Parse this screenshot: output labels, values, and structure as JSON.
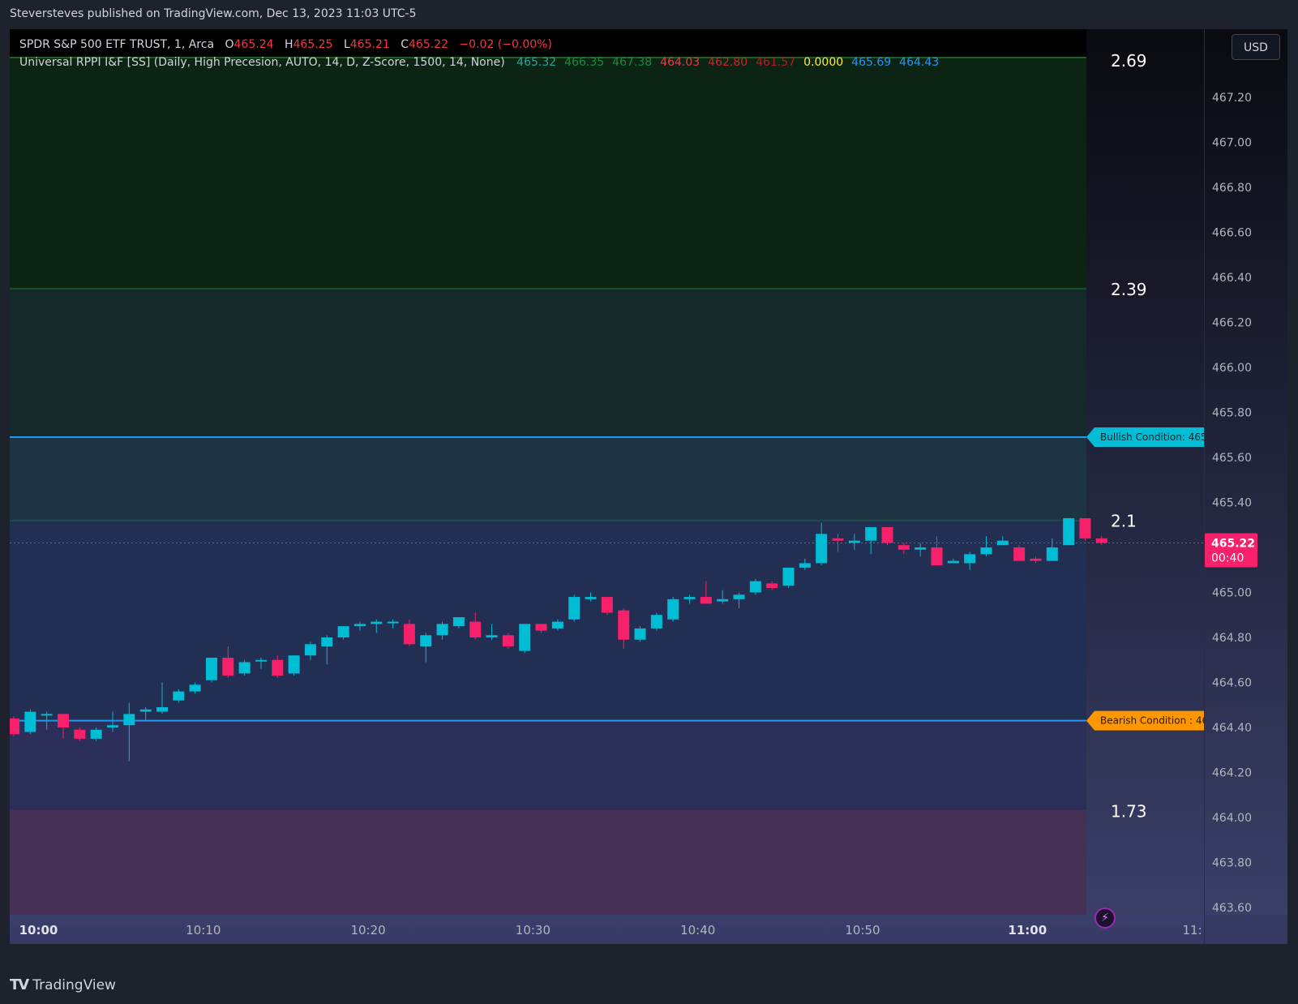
{
  "publisher": "Steversteves published on TradingView.com, Dec 13, 2023 11:03 UTC-5",
  "legend": {
    "symbol": "SPDR S&P 500 ETF TRUST, 1, Arca",
    "open_label": "O",
    "open": "465.24",
    "high_label": "H",
    "high": "465.25",
    "low_label": "L",
    "low": "465.21",
    "close_label": "C",
    "close": "465.22",
    "change": "−0.02 (−0.00%)",
    "indicator": "Universal RPPI I&F [SS] (Daily, High Precesion, AUTO, 14, D, Z-Score, 1500, 14, None)",
    "indicator_values": [
      {
        "text": "465.32",
        "color": "#26a69a"
      },
      {
        "text": "466.35",
        "color": "#1b8a3a"
      },
      {
        "text": "467.38",
        "color": "#1b8a3a"
      },
      {
        "text": "464.03",
        "color": "#f23645"
      },
      {
        "text": "462.80",
        "color": "#c62828"
      },
      {
        "text": "461.57",
        "color": "#b71c1c"
      },
      {
        "text": "0.0000",
        "color": "#ffeb3b"
      },
      {
        "text": "465.69",
        "color": "#2196f3"
      },
      {
        "text": "464.43",
        "color": "#2196f3"
      }
    ]
  },
  "currency": "USD",
  "brand": "TradingView",
  "colors": {
    "up": "#00bcd4",
    "down": "#f7206a",
    "bullish_line": "#2196f3",
    "bearish_tag": "#ff9800",
    "bullish_tag": "#00bcd4",
    "last_price_tag": "#f7206a"
  },
  "chart_data": {
    "type": "candlestick",
    "symbol": "SPY",
    "interval": "1",
    "ylim": [
      463.55,
      467.38
    ],
    "y_ticks": [
      "467.20",
      "467.00",
      "466.80",
      "466.60",
      "466.40",
      "466.20",
      "466.00",
      "465.80",
      "465.60",
      "465.40",
      "465.20",
      "465.00",
      "464.80",
      "464.60",
      "464.40",
      "464.20",
      "464.00",
      "463.80",
      "463.60"
    ],
    "x_labels": [
      {
        "t": 0,
        "text": "10:00",
        "bold": true
      },
      {
        "t": 10,
        "text": "10:10",
        "bold": false
      },
      {
        "t": 20,
        "text": "10:20",
        "bold": false
      },
      {
        "t": 30,
        "text": "10:30",
        "bold": false
      },
      {
        "t": 40,
        "text": "10:40",
        "bold": false
      },
      {
        "t": 50,
        "text": "10:50",
        "bold": false
      },
      {
        "t": 60,
        "text": "11:00",
        "bold": true
      },
      {
        "t": 70,
        "text": "11:",
        "bold": false
      }
    ],
    "x_first": -1.5,
    "candles": [
      [
        -1.5,
        464.44,
        464.37,
        464.45,
        464.36
      ],
      [
        -0.5,
        464.38,
        464.47,
        464.48,
        464.37
      ],
      [
        0.5,
        464.46,
        464.46,
        464.47,
        464.39
      ],
      [
        1.5,
        464.46,
        464.4,
        464.46,
        464.35
      ],
      [
        2.5,
        464.39,
        464.35,
        464.4,
        464.34
      ],
      [
        3.5,
        464.35,
        464.39,
        464.4,
        464.34
      ],
      [
        4.5,
        464.4,
        464.41,
        464.47,
        464.38
      ],
      [
        5.5,
        464.41,
        464.46,
        464.51,
        464.25
      ],
      [
        6.5,
        464.47,
        464.48,
        464.49,
        464.43
      ],
      [
        7.5,
        464.47,
        464.49,
        464.6,
        464.46
      ],
      [
        8.5,
        464.52,
        464.56,
        464.57,
        464.51
      ],
      [
        9.5,
        464.56,
        464.59,
        464.6,
        464.55
      ],
      [
        10.5,
        464.61,
        464.71,
        464.71,
        464.6
      ],
      [
        11.5,
        464.71,
        464.63,
        464.76,
        464.62
      ],
      [
        12.5,
        464.64,
        464.69,
        464.7,
        464.63
      ],
      [
        13.5,
        464.7,
        464.7,
        464.71,
        464.66
      ],
      [
        14.5,
        464.7,
        464.63,
        464.72,
        464.62
      ],
      [
        15.5,
        464.64,
        464.72,
        464.72,
        464.63
      ],
      [
        16.5,
        464.72,
        464.77,
        464.78,
        464.7
      ],
      [
        17.5,
        464.76,
        464.8,
        464.81,
        464.68
      ],
      [
        18.5,
        464.8,
        464.85,
        464.85,
        464.79
      ],
      [
        19.5,
        464.85,
        464.86,
        464.87,
        464.83
      ],
      [
        20.5,
        464.86,
        464.87,
        464.88,
        464.82
      ],
      [
        21.5,
        464.87,
        464.87,
        464.88,
        464.84
      ],
      [
        22.5,
        464.86,
        464.77,
        464.88,
        464.76
      ],
      [
        23.5,
        464.76,
        464.81,
        464.82,
        464.69
      ],
      [
        24.5,
        464.81,
        464.86,
        464.87,
        464.79
      ],
      [
        25.5,
        464.85,
        464.89,
        464.89,
        464.84
      ],
      [
        26.5,
        464.87,
        464.8,
        464.91,
        464.79
      ],
      [
        27.5,
        464.8,
        464.81,
        464.86,
        464.79
      ],
      [
        28.5,
        464.81,
        464.76,
        464.82,
        464.75
      ],
      [
        29.5,
        464.74,
        464.86,
        464.86,
        464.73
      ],
      [
        30.5,
        464.86,
        464.83,
        464.86,
        464.82
      ],
      [
        31.5,
        464.84,
        464.87,
        464.88,
        464.83
      ],
      [
        32.5,
        464.88,
        464.98,
        464.99,
        464.87
      ],
      [
        33.5,
        464.97,
        464.98,
        465.0,
        464.96
      ],
      [
        34.5,
        464.98,
        464.91,
        464.98,
        464.9
      ],
      [
        35.5,
        464.92,
        464.79,
        464.93,
        464.75
      ],
      [
        36.5,
        464.79,
        464.84,
        464.85,
        464.78
      ],
      [
        37.5,
        464.84,
        464.9,
        464.91,
        464.83
      ],
      [
        38.5,
        464.88,
        464.97,
        464.98,
        464.87
      ],
      [
        39.5,
        464.97,
        464.98,
        464.99,
        464.95
      ],
      [
        40.5,
        464.98,
        464.95,
        465.05,
        464.95
      ],
      [
        41.5,
        464.96,
        464.97,
        465.01,
        464.95
      ],
      [
        42.5,
        464.97,
        464.99,
        465.0,
        464.93
      ],
      [
        43.5,
        465.0,
        465.05,
        465.06,
        464.99
      ],
      [
        44.5,
        465.04,
        465.02,
        465.05,
        465.01
      ],
      [
        45.5,
        465.03,
        465.11,
        465.11,
        465.02
      ],
      [
        46.5,
        465.11,
        465.13,
        465.15,
        465.1
      ],
      [
        47.5,
        465.13,
        465.26,
        465.31,
        465.12
      ],
      [
        48.5,
        465.24,
        465.23,
        465.26,
        465.18
      ],
      [
        49.5,
        465.22,
        465.23,
        465.26,
        465.19
      ],
      [
        50.5,
        465.23,
        465.29,
        465.29,
        465.17
      ],
      [
        51.5,
        465.29,
        465.22,
        465.29,
        465.21
      ],
      [
        52.5,
        465.21,
        465.19,
        465.22,
        465.17
      ],
      [
        53.5,
        465.19,
        465.2,
        465.22,
        465.16
      ],
      [
        54.5,
        465.2,
        465.12,
        465.25,
        465.12
      ],
      [
        55.5,
        465.13,
        465.14,
        465.15,
        465.13
      ],
      [
        56.5,
        465.13,
        465.17,
        465.18,
        465.1
      ],
      [
        57.5,
        465.17,
        465.2,
        465.25,
        465.16
      ],
      [
        58.5,
        465.21,
        465.23,
        465.25,
        465.21
      ],
      [
        59.5,
        465.2,
        465.14,
        465.21,
        465.14
      ],
      [
        60.5,
        465.15,
        465.14,
        465.16,
        465.13
      ],
      [
        61.5,
        465.14,
        465.2,
        465.24,
        465.14
      ],
      [
        62.5,
        465.21,
        465.33,
        465.33,
        465.21
      ],
      [
        63.5,
        465.33,
        465.24,
        465.33,
        465.23
      ],
      [
        64.5,
        465.24,
        465.22,
        465.25,
        465.21
      ]
    ],
    "bands": [
      {
        "from": 466.35,
        "to": 467.38,
        "color": "#0c2413"
      },
      {
        "from": 465.69,
        "to": 466.35,
        "color": "#15282a"
      },
      {
        "from": 465.32,
        "to": 465.69,
        "color": "#1d3443"
      },
      {
        "from": 464.43,
        "to": 465.32,
        "color": "#222f53"
      },
      {
        "from": 464.03,
        "to": 464.43,
        "color": "#2c2f5a"
      },
      {
        "from": 463.55,
        "to": 464.03,
        "color": "#473056"
      }
    ],
    "zscore_labels": [
      {
        "y": 467.38,
        "text": "2.69"
      },
      {
        "y": 466.35,
        "text": "2.39"
      },
      {
        "y": 465.32,
        "text": "2.1"
      },
      {
        "y": 464.03,
        "text": "1.73"
      }
    ],
    "bullish_line": {
      "y": 465.69,
      "label": "Bullish Condition: 465."
    },
    "bearish_line": {
      "y": 464.43,
      "label": "Bearish Condition : 464"
    },
    "last_price": {
      "value": "465.22",
      "countdown": "00:40"
    }
  }
}
